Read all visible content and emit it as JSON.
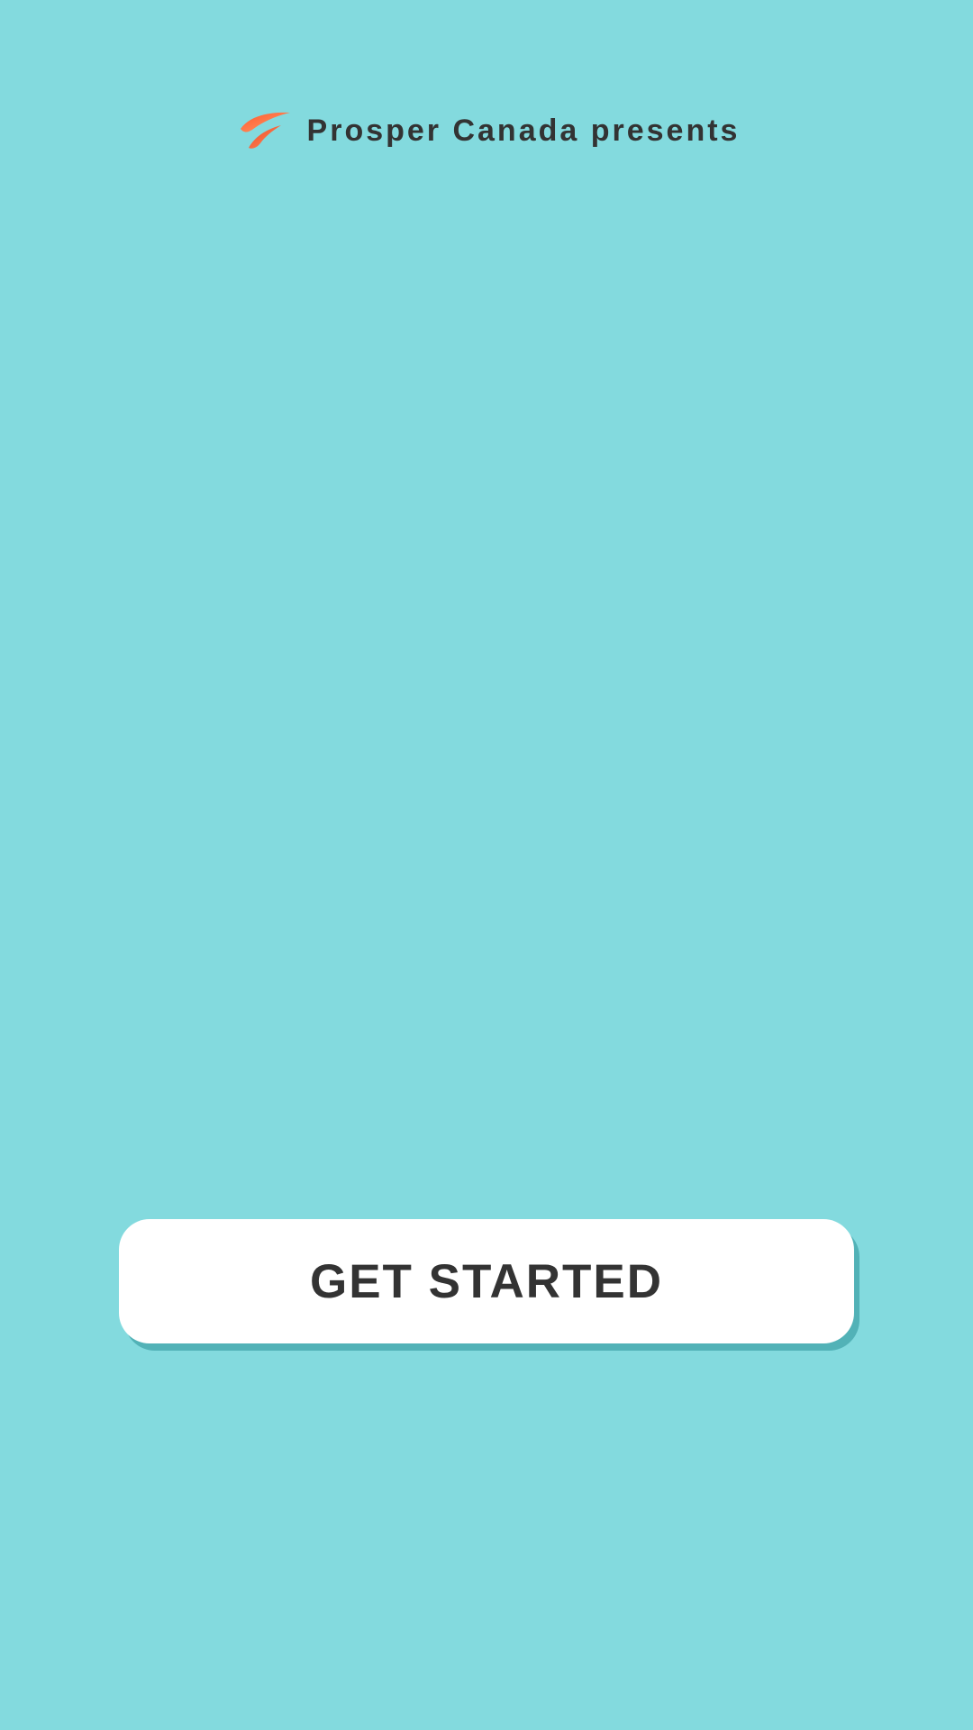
{
  "header": {
    "brand_text": "Prosper Canada presents",
    "logo_icon": "prosper-canada-leaf-logo"
  },
  "actions": {
    "get_started_label": "GET STARTED"
  },
  "colors": {
    "background": "#83dade",
    "button_background": "#ffffff",
    "text": "#333333",
    "logo_primary": "#ff6a3d",
    "logo_secondary": "#ef4b27"
  }
}
